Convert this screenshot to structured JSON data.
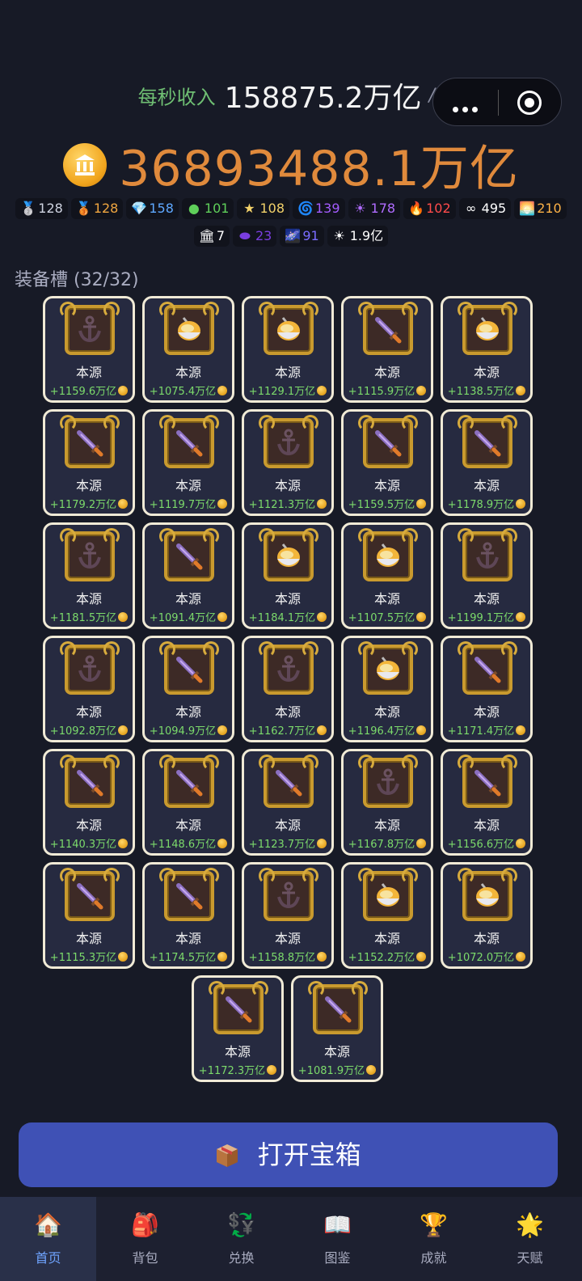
{
  "header": {
    "income_label": "每秒收入",
    "income_value": "158875.2万亿",
    "income_unit": "/s",
    "gold_value": "36893488.1万亿"
  },
  "stats_row1": [
    {
      "icon": "silver-medal-icon",
      "glyph": "🥈",
      "value": "128",
      "color": "#cfd3e0"
    },
    {
      "icon": "bronze-medal-icon",
      "glyph": "🥉",
      "value": "128",
      "color": "#f0a640"
    },
    {
      "icon": "diamond-icon",
      "glyph": "💎",
      "value": "158",
      "color": "#5ea8ff"
    },
    {
      "icon": "green-orb-icon",
      "glyph": "●",
      "value": "101",
      "color": "#5fcf5a"
    },
    {
      "icon": "star-icon",
      "glyph": "★",
      "value": "108",
      "color": "#f3d26a"
    },
    {
      "icon": "swirl-icon",
      "glyph": "🌀",
      "value": "139",
      "color": "#a45cff"
    },
    {
      "icon": "sun-icon",
      "glyph": "☀",
      "value": "178",
      "color": "#b06cff"
    },
    {
      "icon": "fire-icon",
      "glyph": "🔥",
      "value": "102",
      "color": "#ff4b4b"
    },
    {
      "icon": "infinity-icon",
      "glyph": "∞",
      "value": "495",
      "color": "#ffffff"
    },
    {
      "icon": "sunrise-icon",
      "glyph": "🌅",
      "value": "210",
      "color": "#ffb347"
    }
  ],
  "stats_row2": [
    {
      "icon": "bank-icon",
      "glyph": "🏛",
      "value": "7",
      "color": "#ffffff"
    },
    {
      "icon": "ring-icon",
      "glyph": "⬬",
      "value": "23",
      "color": "#7a3ee0"
    },
    {
      "icon": "galaxy-icon",
      "glyph": "🌌",
      "value": "91",
      "color": "#7a6cff"
    },
    {
      "icon": "bright-sun-icon",
      "glyph": "☀",
      "value": "1.9亿",
      "color": "#ffffff"
    }
  ],
  "slots_title": "装备槽 (32/32)",
  "slots": [
    {
      "item": "anchor",
      "name": "本源",
      "bonus": "+1159.6万亿"
    },
    {
      "item": "bowl",
      "name": "本源",
      "bonus": "+1075.4万亿"
    },
    {
      "item": "bowl",
      "name": "本源",
      "bonus": "+1129.1万亿"
    },
    {
      "item": "dagger",
      "name": "本源",
      "bonus": "+1115.9万亿"
    },
    {
      "item": "bowl",
      "name": "本源",
      "bonus": "+1138.5万亿"
    },
    {
      "item": "dagger",
      "name": "本源",
      "bonus": "+1179.2万亿"
    },
    {
      "item": "dagger",
      "name": "本源",
      "bonus": "+1119.7万亿"
    },
    {
      "item": "anchor",
      "name": "本源",
      "bonus": "+1121.3万亿"
    },
    {
      "item": "dagger",
      "name": "本源",
      "bonus": "+1159.5万亿"
    },
    {
      "item": "dagger",
      "name": "本源",
      "bonus": "+1178.9万亿"
    },
    {
      "item": "anchor",
      "name": "本源",
      "bonus": "+1181.5万亿"
    },
    {
      "item": "dagger",
      "name": "本源",
      "bonus": "+1091.4万亿"
    },
    {
      "item": "bowl",
      "name": "本源",
      "bonus": "+1184.1万亿"
    },
    {
      "item": "bowl",
      "name": "本源",
      "bonus": "+1107.5万亿"
    },
    {
      "item": "anchor",
      "name": "本源",
      "bonus": "+1199.1万亿"
    },
    {
      "item": "anchor",
      "name": "本源",
      "bonus": "+1092.8万亿"
    },
    {
      "item": "dagger",
      "name": "本源",
      "bonus": "+1094.9万亿"
    },
    {
      "item": "anchor",
      "name": "本源",
      "bonus": "+1162.7万亿"
    },
    {
      "item": "bowl",
      "name": "本源",
      "bonus": "+1196.4万亿"
    },
    {
      "item": "dagger",
      "name": "本源",
      "bonus": "+1171.4万亿"
    },
    {
      "item": "dagger",
      "name": "本源",
      "bonus": "+1140.3万亿"
    },
    {
      "item": "dagger",
      "name": "本源",
      "bonus": "+1148.6万亿"
    },
    {
      "item": "dagger",
      "name": "本源",
      "bonus": "+1123.7万亿"
    },
    {
      "item": "anchor",
      "name": "本源",
      "bonus": "+1167.8万亿"
    },
    {
      "item": "dagger",
      "name": "本源",
      "bonus": "+1156.6万亿"
    },
    {
      "item": "dagger",
      "name": "本源",
      "bonus": "+1115.3万亿"
    },
    {
      "item": "dagger",
      "name": "本源",
      "bonus": "+1174.5万亿"
    },
    {
      "item": "anchor",
      "name": "本源",
      "bonus": "+1158.8万亿"
    },
    {
      "item": "bowl",
      "name": "本源",
      "bonus": "+1152.2万亿"
    },
    {
      "item": "bowl",
      "name": "本源",
      "bonus": "+1072.0万亿"
    },
    {
      "item": "dagger",
      "name": "本源",
      "bonus": "+1172.3万亿"
    },
    {
      "item": "dagger",
      "name": "本源",
      "bonus": "+1081.9万亿"
    }
  ],
  "open_button": "打开宝箱",
  "tabs": [
    {
      "id": "home",
      "icon": "house-icon",
      "glyph": "🏠",
      "label": "首页",
      "active": true
    },
    {
      "id": "backpack",
      "icon": "backpack-icon",
      "glyph": "🎒",
      "label": "背包",
      "active": false
    },
    {
      "id": "exchange",
      "icon": "currency-exchange-icon",
      "glyph": "💱",
      "label": "兑换",
      "active": false
    },
    {
      "id": "codex",
      "icon": "book-icon",
      "glyph": "📖",
      "label": "图鉴",
      "active": false
    },
    {
      "id": "achievements",
      "icon": "trophy-icon",
      "glyph": "🏆",
      "label": "成就",
      "active": false
    },
    {
      "id": "talent",
      "icon": "star-burst-icon",
      "glyph": "🌟",
      "label": "天赋",
      "active": false
    }
  ],
  "colors": {
    "background": "#171a26",
    "gold": "#e08a3c",
    "income_label": "#6fbf73",
    "bonus_green": "#7cdb6b",
    "button_blue": "#3f51b5",
    "active_tab": "#6fa4ff"
  }
}
